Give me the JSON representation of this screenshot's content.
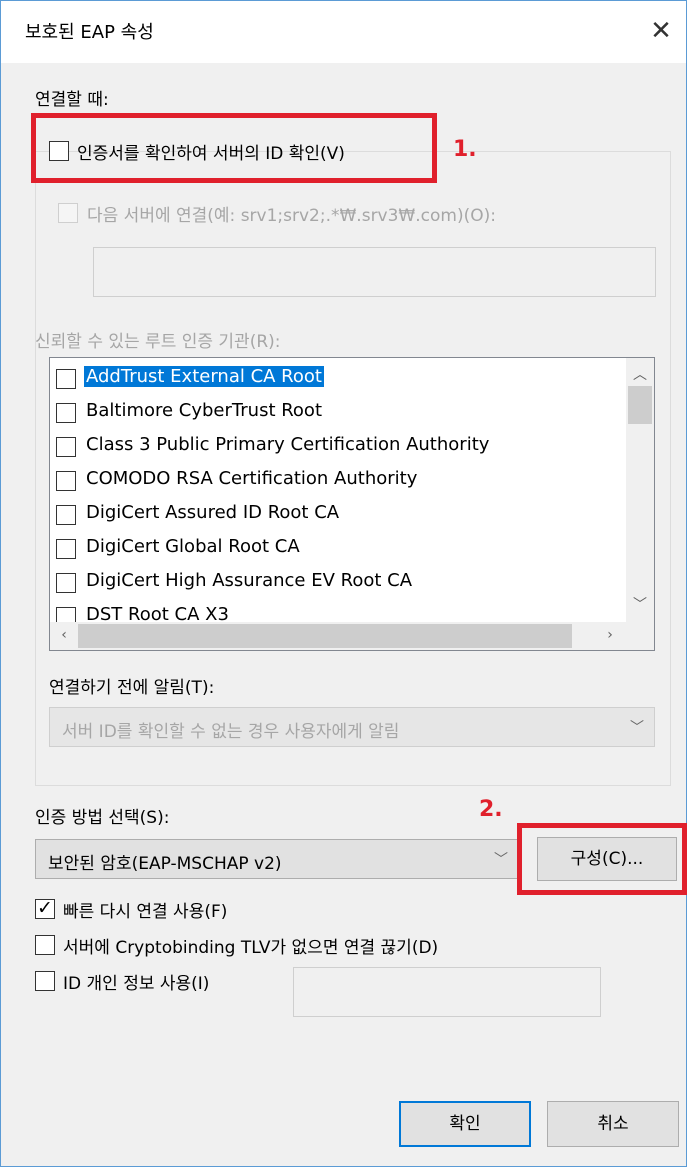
{
  "window": {
    "title": "보호된 EAP 속성",
    "close_glyph": "✕"
  },
  "connect": {
    "heading": "연결할 때:",
    "verify_cert_label": "인증서를 확인하여 서버의 ID 확인(V)",
    "verify_cert_checked": false,
    "connect_servers_label": "다음 서버에 연결(예: srv1;srv2;.*₩.srv3₩.com)(O):",
    "servers_value": "",
    "trusted_ca_label": "신뢰할 수 있는 루트 인증 기관(R):"
  },
  "ca_list": {
    "items": [
      {
        "label": "AddTrust External CA Root",
        "checked": false,
        "selected": true
      },
      {
        "label": "Baltimore CyberTrust Root",
        "checked": false,
        "selected": false
      },
      {
        "label": "Class 3 Public Primary Certification Authority",
        "checked": false,
        "selected": false
      },
      {
        "label": "COMODO RSA Certification Authority",
        "checked": false,
        "selected": false
      },
      {
        "label": "DigiCert Assured ID Root CA",
        "checked": false,
        "selected": false
      },
      {
        "label": "DigiCert Global Root CA",
        "checked": false,
        "selected": false
      },
      {
        "label": "DigiCert High Assurance EV Root CA",
        "checked": false,
        "selected": false
      },
      {
        "label": "DST Root CA X3",
        "checked": false,
        "selected": false
      }
    ]
  },
  "notify": {
    "label": "연결하기 전에 알림(T):",
    "selected": "서버 ID를 확인할 수 없는 경우 사용자에게 알림"
  },
  "auth": {
    "label": "인증 방법 선택(S):",
    "selected": "보안된 암호(EAP-MSCHAP v2)",
    "configure_label": "구성(C)..."
  },
  "options": {
    "fast_reconnect_label": "빠른 다시 연결 사용(F)",
    "fast_reconnect_checked": true,
    "disconnect_label": "서버에 Cryptobinding TLV가 없으면 연결 끊기(D)",
    "disconnect_checked": false,
    "privacy_label": "ID 개인 정보 사용(I)",
    "privacy_checked": false,
    "privacy_value": ""
  },
  "footer": {
    "ok_label": "확인",
    "cancel_label": "취소"
  },
  "annotations": {
    "step1": "1.",
    "step2": "2.",
    "highlight_color": "#e0202c"
  },
  "colors": {
    "selection": "#0078d7",
    "window_border": "#5b9bd5"
  }
}
